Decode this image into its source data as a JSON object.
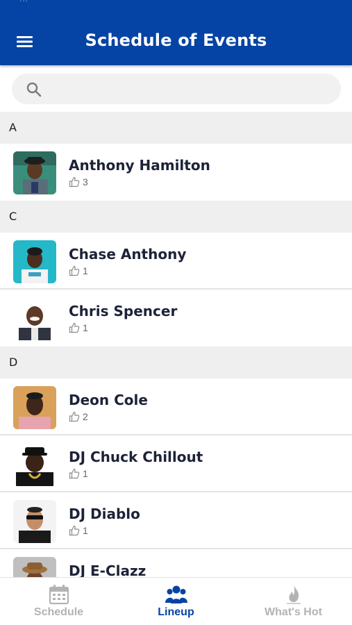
{
  "header": {
    "status_text": "...",
    "title": "Schedule of Events"
  },
  "search": {
    "placeholder": "",
    "value": ""
  },
  "sections": [
    {
      "letter": "A",
      "performers": [
        {
          "name": "Anthony Hamilton",
          "likes": "3"
        }
      ]
    },
    {
      "letter": "C",
      "performers": [
        {
          "name": "Chase Anthony",
          "likes": "1"
        },
        {
          "name": "Chris Spencer",
          "likes": "1"
        }
      ]
    },
    {
      "letter": "D",
      "performers": [
        {
          "name": "Deon Cole",
          "likes": "2"
        },
        {
          "name": "DJ Chuck Chillout",
          "likes": "1"
        },
        {
          "name": "DJ Diablo",
          "likes": "1"
        },
        {
          "name": "DJ E-Clazz",
          "likes": ""
        }
      ]
    }
  ],
  "tabs": [
    {
      "label": "Schedule",
      "icon": "calendar-icon",
      "active": false
    },
    {
      "label": "Lineup",
      "icon": "people-icon",
      "active": true
    },
    {
      "label": "What's Hot",
      "icon": "fire-icon",
      "active": false
    }
  ],
  "colors": {
    "brand": "#0544a4",
    "section_bg": "#efefef",
    "inactive_tab": "#b3b3b3"
  }
}
